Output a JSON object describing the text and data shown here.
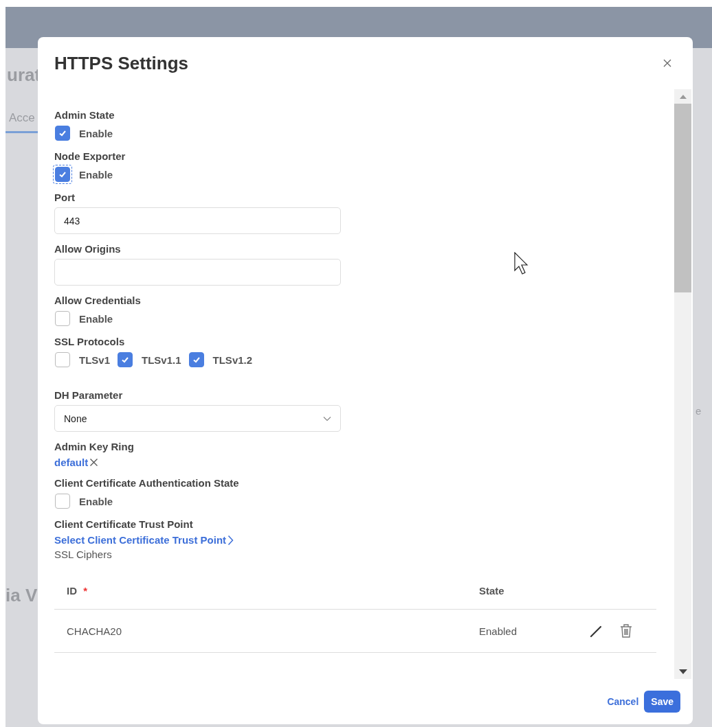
{
  "background": {
    "heading_fragment": "urat",
    "tab_fragment": "Acce",
    "section_fragment": "ia V",
    "edge_fragment": "e"
  },
  "dialog": {
    "title": "HTTPS Settings"
  },
  "fields": [
    {
      "kind": "checkbox",
      "label": "Admin State",
      "options": [
        {
          "label": "Enable",
          "checked": true,
          "focused": false
        }
      ]
    },
    {
      "kind": "checkbox",
      "label": "Node Exporter",
      "options": [
        {
          "label": "Enable",
          "checked": true,
          "focused": true
        }
      ]
    },
    {
      "kind": "text",
      "label": "Port",
      "value": "443"
    },
    {
      "kind": "text",
      "label": "Allow Origins"
    },
    {
      "kind": "checkbox",
      "label": "Allow Credentials",
      "options": [
        {
          "label": "Enable",
          "checked": false,
          "focused": false
        }
      ]
    },
    {
      "kind": "checkbox",
      "label": "SSL Protocols",
      "options": [
        {
          "label": "TLSv1",
          "checked": false,
          "focused": false
        },
        {
          "label": "TLSv1.1",
          "checked": true,
          "focused": false
        },
        {
          "label": "TLSv1.2",
          "checked": true,
          "focused": false
        }
      ]
    },
    {
      "kind": "select",
      "label": "DH Parameter",
      "value": "None"
    },
    {
      "kind": "tag",
      "label": "Admin Key Ring",
      "value": "default"
    },
    {
      "kind": "checkbox",
      "label": "Client Certificate Authentication State",
      "options": [
        {
          "label": "Enable",
          "checked": false,
          "focused": false
        }
      ]
    },
    {
      "kind": "link",
      "label": "Client Certificate Trust Point",
      "value": "Select Client Certificate Trust Point"
    }
  ],
  "ciphers": {
    "title": "SSL Ciphers",
    "columns": [
      {
        "label": "ID",
        "required_mark": "*"
      },
      {
        "label": "State"
      }
    ],
    "rows": [
      {
        "id": "CHACHA20",
        "state": "Enabled"
      }
    ]
  },
  "footer": {
    "cancel": "Cancel",
    "save": "Save"
  }
}
